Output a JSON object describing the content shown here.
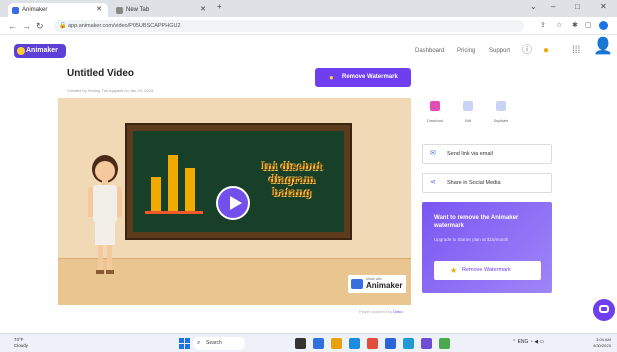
{
  "browser": {
    "tabs": [
      {
        "label": "Animaker",
        "favicon_color": "#3b6be0"
      },
      {
        "label": "New Tab",
        "favicon_color": "#888888"
      }
    ],
    "new_tab_label": "+",
    "url": "app.animaker.com/video/P05UBSCAPPHGU2",
    "window_controls": [
      "⌄",
      "–",
      "□",
      "✕"
    ]
  },
  "header": {
    "logo_text": "Animaker",
    "links": [
      "Dashboard",
      "Pricing",
      "Support"
    ]
  },
  "project": {
    "title": "Untitled Video",
    "subtitle": "Created by Hening Tiar Ajayanti on Jan 29, 2023",
    "remove_watermark_label": "Remove Watermark"
  },
  "video": {
    "board_text_lines": [
      "Ini disebut",
      "diagram",
      "batang"
    ],
    "watermark_small": "Made with",
    "watermark_text": "Animaker",
    "bars": [
      {
        "value": 0.55
      },
      {
        "value": 0.9
      },
      {
        "value": 0.7
      }
    ]
  },
  "credit": {
    "prefix": "Player powered by",
    "brand": "Deko"
  },
  "tools": [
    {
      "label": "Download",
      "color": "#e24db3"
    },
    {
      "label": "Edit",
      "color": "#c9d3f4"
    },
    {
      "label": "Duplicate",
      "color": "#c9d3f4"
    }
  ],
  "share": {
    "email_label": "Send link via email",
    "social_label": "Share in Social Media"
  },
  "promo": {
    "title": "Want to remove the Animaker watermark",
    "desc": "Upgrade to Starter plan at $15/month",
    "button_label": "Remove Watermark"
  },
  "taskbar": {
    "weather_temp": "73°F",
    "weather_desc": "Cloudy",
    "search_label": "Search",
    "apps_colors": [
      "#333333",
      "#2f6fe0",
      "#e8a10f",
      "#1a8be0",
      "#e54d3b",
      "#2a64d8",
      "#1f9ad6",
      "#6b4ed4",
      "#4ca84c"
    ],
    "tray_text": "ENG",
    "time": "3:04 AM",
    "date": "4/30/2023"
  }
}
